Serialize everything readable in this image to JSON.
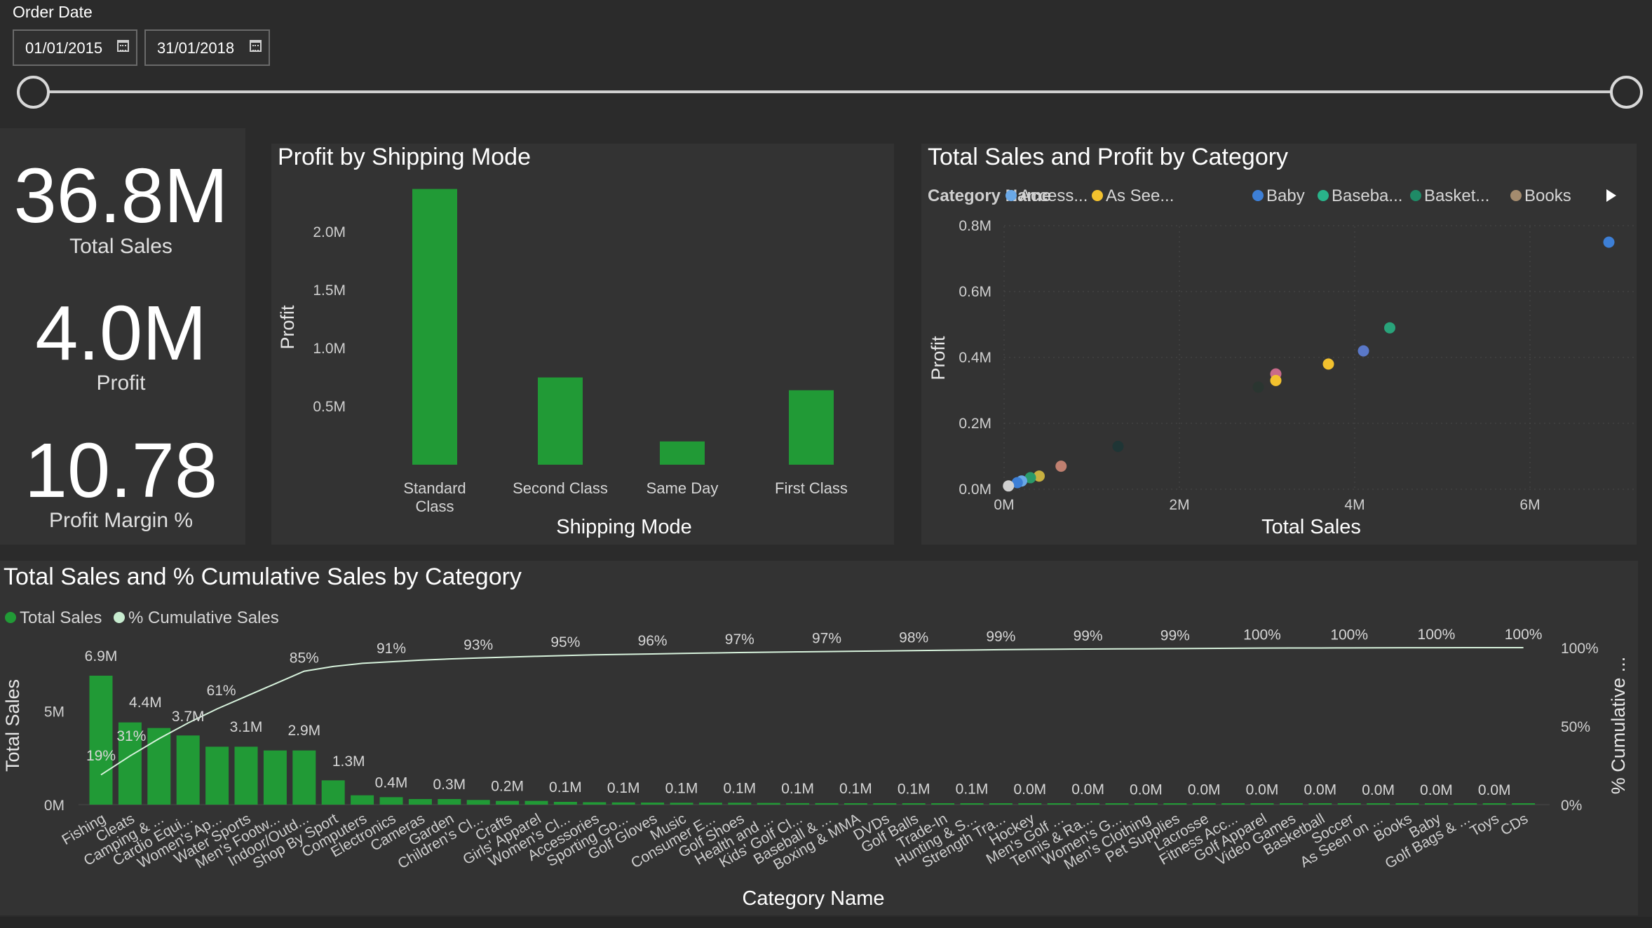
{
  "filter": {
    "label": "Order Date",
    "start_date": "01/01/2015",
    "end_date": "31/01/2018"
  },
  "kpis": {
    "total_sales": {
      "value": "36.8M",
      "label": "Total Sales"
    },
    "profit": {
      "value": "4.0M",
      "label": "Profit"
    },
    "profit_margin": {
      "value": "10.78",
      "label": "Profit Margin %"
    }
  },
  "colors": {
    "bar_green": "#219a36",
    "line_color": "#d7f2dc",
    "background": "#2b2b2b",
    "panel": "#333333"
  },
  "chart_data": [
    {
      "id": "shipping",
      "type": "bar",
      "title": "Profit by Shipping Mode",
      "xlabel": "Shipping Mode",
      "ylabel": "Profit",
      "categories": [
        [
          "Standard",
          "Class"
        ],
        [
          "Second Class"
        ],
        [
          "Same Day"
        ],
        [
          "First Class"
        ]
      ],
      "values": [
        2.37,
        0.75,
        0.2,
        0.64
      ],
      "ylim": [
        0,
        2.5
      ],
      "yticks": [
        0.5,
        1.0,
        1.5,
        2.0
      ],
      "ytick_labels": [
        "0.5M",
        "1.0M",
        "1.5M",
        "2.0M"
      ],
      "grid": false
    },
    {
      "id": "scatter",
      "type": "scatter",
      "title": "Total Sales and Profit by Category",
      "xlabel": "Total Sales",
      "ylabel": "Profit",
      "legend_title": "Category Name",
      "legend": [
        {
          "name": "Access...",
          "color": "#6aa8e6"
        },
        {
          "name": "As See...",
          "color": "#f2c12e"
        },
        {
          "name": "Baby",
          "color": "#3d7fd6"
        },
        {
          "name": "Baseba...",
          "color": "#29b38a"
        },
        {
          "name": "Basket...",
          "color": "#1f8a66"
        },
        {
          "name": "Books",
          "color": "#a48b6e"
        }
      ],
      "xlim": [
        0,
        7
      ],
      "ylim": [
        0,
        0.8
      ],
      "xticks": [
        0,
        2,
        4,
        6
      ],
      "xtick_labels": [
        "0M",
        "2M",
        "4M",
        "6M"
      ],
      "yticks": [
        0,
        0.2,
        0.4,
        0.6,
        0.8
      ],
      "ytick_labels": [
        "0.0M",
        "0.2M",
        "0.4M",
        "0.6M",
        "0.8M"
      ],
      "grid": true,
      "points": [
        {
          "x": 6.9,
          "y": 0.75,
          "color": "#3d7fd6"
        },
        {
          "x": 4.4,
          "y": 0.49,
          "color": "#29a37a"
        },
        {
          "x": 4.1,
          "y": 0.42,
          "color": "#5a78c8"
        },
        {
          "x": 3.7,
          "y": 0.38,
          "color": "#f2c12e"
        },
        {
          "x": 3.1,
          "y": 0.35,
          "color": "#c86a8a"
        },
        {
          "x": 3.1,
          "y": 0.33,
          "color": "#f2c12e"
        },
        {
          "x": 2.9,
          "y": 0.31,
          "color": "#2a3530"
        },
        {
          "x": 1.3,
          "y": 0.13,
          "color": "#1f3535"
        },
        {
          "x": 0.65,
          "y": 0.07,
          "color": "#c08070"
        },
        {
          "x": 0.4,
          "y": 0.04,
          "color": "#c8b040"
        },
        {
          "x": 0.3,
          "y": 0.035,
          "color": "#2a9a6a"
        },
        {
          "x": 0.2,
          "y": 0.025,
          "color": "#6aa8e6"
        },
        {
          "x": 0.15,
          "y": 0.02,
          "color": "#3d7fd6"
        },
        {
          "x": 0.05,
          "y": 0.01,
          "color": "#d0d0d0"
        }
      ]
    },
    {
      "id": "pareto",
      "type": "bar",
      "title": "Total Sales and % Cumulative Sales by Category",
      "xlabel": "Category Name",
      "ylabel": "Total Sales",
      "ylabel_right": "% Cumulative ...",
      "legend": [
        {
          "name": "Total Sales",
          "color": "#219a36"
        },
        {
          "name": "% Cumulative Sales",
          "color": "#c8ecd0"
        }
      ],
      "categories": [
        "Fishing",
        "Cleats",
        "Camping & ...",
        "Cardio Equi...",
        "Women's Ap...",
        "Water Sports",
        "Men's Footw...",
        "Indoor/Outd...",
        "Shop By Sport",
        "Computers",
        "Electronics",
        "Cameras",
        "Garden",
        "Children's Cl...",
        "Crafts",
        "Girls' Apparel",
        "Women's Cl...",
        "Accessories",
        "Sporting Go...",
        "Golf Gloves",
        "Music",
        "Consumer E...",
        "Golf Shoes",
        "Health and ...",
        "Kids' Golf Cl...",
        "Baseball & ...",
        "Boxing & MMA",
        "DVDs",
        "Golf Balls",
        "Trade-In",
        "Hunting & S...",
        "Strength Tra...",
        "Hockey",
        "Men's Golf ...",
        "Tennis & Ra...",
        "Women's G...",
        "Men's Clothing",
        "Pet Supplies",
        "Lacrosse",
        "Fitness Acc...",
        "Golf Apparel",
        "Video Games",
        "Basketball",
        "Soccer",
        "As Seen on ...",
        "Books",
        "Baby",
        "Golf Bags & ...",
        "Toys",
        "CDs"
      ],
      "values": [
        6.9,
        4.4,
        4.1,
        3.7,
        3.1,
        3.1,
        2.9,
        2.9,
        1.3,
        0.5,
        0.4,
        0.3,
        0.3,
        0.25,
        0.2,
        0.2,
        0.15,
        0.13,
        0.12,
        0.11,
        0.1,
        0.1,
        0.1,
        0.09,
        0.08,
        0.08,
        0.07,
        0.06,
        0.06,
        0.05,
        0.05,
        0.04,
        0.04,
        0.03,
        0.03,
        0.03,
        0.02,
        0.02,
        0.02,
        0.02,
        0.015,
        0.012,
        0.01,
        0.01,
        0.008,
        0.006,
        0.005,
        0.004,
        0.003,
        0.002
      ],
      "cumulative_pct": [
        19,
        31,
        42,
        52,
        61,
        69,
        77,
        85,
        88,
        90,
        91,
        92,
        92.8,
        93.4,
        94,
        94.5,
        95,
        95.4,
        95.7,
        96,
        96.3,
        96.6,
        96.9,
        97.1,
        97.3,
        97.5,
        97.7,
        97.9,
        98.1,
        98.3,
        98.5,
        98.7,
        98.9,
        99,
        99.1,
        99.2,
        99.3,
        99.4,
        99.5,
        99.6,
        99.7,
        99.75,
        99.8,
        99.85,
        99.9,
        99.93,
        99.96,
        99.98,
        99.99,
        100
      ],
      "bar_labels": [
        {
          "index": 0,
          "text": "6.9M"
        },
        {
          "index": 1,
          "text": "4.4M"
        },
        {
          "index": 3,
          "text": "3.7M"
        },
        {
          "index": 5,
          "text": "3.1M"
        },
        {
          "index": 7,
          "text": "2.9M"
        },
        {
          "index": 8,
          "text": "1.3M"
        },
        {
          "index": 10,
          "text": "0.4M"
        },
        {
          "index": 12,
          "text": "0.3M"
        },
        {
          "index": 14,
          "text": "0.2M"
        },
        {
          "index": 16,
          "text": "0.1M"
        },
        {
          "index": 18,
          "text": "0.1M"
        },
        {
          "index": 20,
          "text": "0.1M"
        },
        {
          "index": 22,
          "text": "0.1M"
        },
        {
          "index": 24,
          "text": "0.1M"
        },
        {
          "index": 26,
          "text": "0.1M"
        },
        {
          "index": 28,
          "text": "0.1M"
        },
        {
          "index": 30,
          "text": "0.1M"
        },
        {
          "index": 32,
          "text": "0.0M"
        },
        {
          "index": 34,
          "text": "0.0M"
        },
        {
          "index": 36,
          "text": "0.0M"
        },
        {
          "index": 38,
          "text": "0.0M"
        },
        {
          "index": 40,
          "text": "0.0M"
        },
        {
          "index": 42,
          "text": "0.0M"
        },
        {
          "index": 44,
          "text": "0.0M"
        },
        {
          "index": 46,
          "text": "0.0M"
        },
        {
          "index": 48,
          "text": "0.0M"
        }
      ],
      "pct_labels": [
        {
          "index": 0,
          "text": "19%"
        },
        {
          "index": 1,
          "text": "31%"
        },
        {
          "index": 4,
          "text": "61%"
        },
        {
          "index": 7,
          "text": "85%"
        },
        {
          "index": 10,
          "text": "91%"
        },
        {
          "index": 13,
          "text": "93%"
        },
        {
          "index": 16,
          "text": "95%"
        },
        {
          "index": 19,
          "text": "96%"
        },
        {
          "index": 22,
          "text": "97%"
        },
        {
          "index": 25,
          "text": "97%"
        },
        {
          "index": 28,
          "text": "98%"
        },
        {
          "index": 31,
          "text": "99%"
        },
        {
          "index": 34,
          "text": "99%"
        },
        {
          "index": 37,
          "text": "99%"
        },
        {
          "index": 40,
          "text": "100%"
        },
        {
          "index": 43,
          "text": "100%"
        },
        {
          "index": 46,
          "text": "100%"
        },
        {
          "index": 49,
          "text": "100%"
        }
      ],
      "ylim": [
        0,
        7.6
      ],
      "yticks": [
        0,
        5
      ],
      "ytick_labels": [
        "0M",
        "5M"
      ],
      "y2lim": [
        0,
        100
      ],
      "y2ticks": [
        0,
        50,
        100
      ],
      "y2tick_labels": [
        "0%",
        "50%",
        "100%"
      ]
    }
  ]
}
